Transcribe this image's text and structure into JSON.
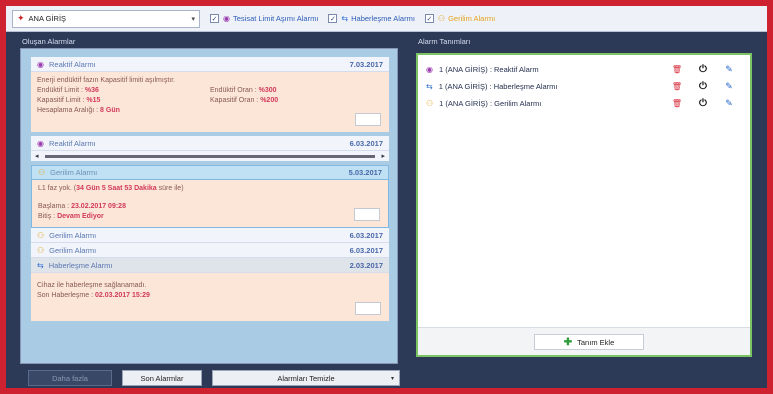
{
  "toolbar": {
    "device": "ANA GİRİŞ",
    "filters": [
      {
        "label": "Tesisat Limit Aşımı Alarmı",
        "icon": "eye-icon"
      },
      {
        "label": "Haberleşme Alarmı",
        "icon": "usb-icon"
      },
      {
        "label": "Gerilim Alarmı",
        "icon": "link-icon"
      }
    ]
  },
  "left_panel": {
    "title": "Oluşan Alarmlar",
    "alarms": [
      {
        "title": "Reaktif Alarmı",
        "date": "7.03.2017",
        "desc": "Enerji endüktif fazın Kapasitif limiti aşılmıştır.",
        "ind_limit_label": "Endüktif Limit :",
        "ind_limit": "%36",
        "ind_ratio_label": "Endüktif Oran :",
        "ind_ratio": "%300",
        "cap_limit_label": "Kapasitif Limit :",
        "cap_limit": "%15",
        "cap_ratio_label": "Kapasitif Oran :",
        "cap_ratio": "%200",
        "interval_label": "Hesaplama Aralığı :",
        "interval": "8 Gün"
      },
      {
        "title": "Reaktif Alarmı",
        "date": "6.03.2017"
      },
      {
        "title": "Gerilim Alarmı",
        "date": "5.03.2017",
        "desc_prefix": "L1 faz yok. (",
        "duration": "34 Gün 5 Saat 53 Dakika",
        "desc_suffix": " süre ile)",
        "start_label": "Başlama :",
        "start": "23.02.2017 09:28",
        "end_label": "Bitiş :",
        "end": "Devam Ediyor"
      },
      {
        "title": "Gerilim Alarmı",
        "date": "6.03.2017"
      },
      {
        "title": "Gerilim Alarmı",
        "date": "6.03.2017"
      },
      {
        "title": "Haberleşme Alarmı",
        "date": "2.03.2017",
        "desc": "Cihaz ile haberleşme sağlanamadı.",
        "last_label": "Son Haberleşme :",
        "last": "02.03.2017 15:29"
      }
    ]
  },
  "right_panel": {
    "title": "Alarm Tanımları",
    "rules": [
      {
        "icon": "eye-icon",
        "text": "1 (ANA GİRİŞ) : Reaktif Alarm"
      },
      {
        "icon": "usb-icon",
        "text": "1 (ANA GİRİŞ) : Haberleşme Alarmı"
      },
      {
        "icon": "link-icon",
        "text": "1 (ANA GİRİŞ) : Gerilim Alarmı"
      }
    ],
    "add_label": "Tanım Ekle"
  },
  "bottom": {
    "btn1": "Daha fazla",
    "btn2": "Son Alarmlar",
    "btn3": "Alarmları Temizle"
  }
}
